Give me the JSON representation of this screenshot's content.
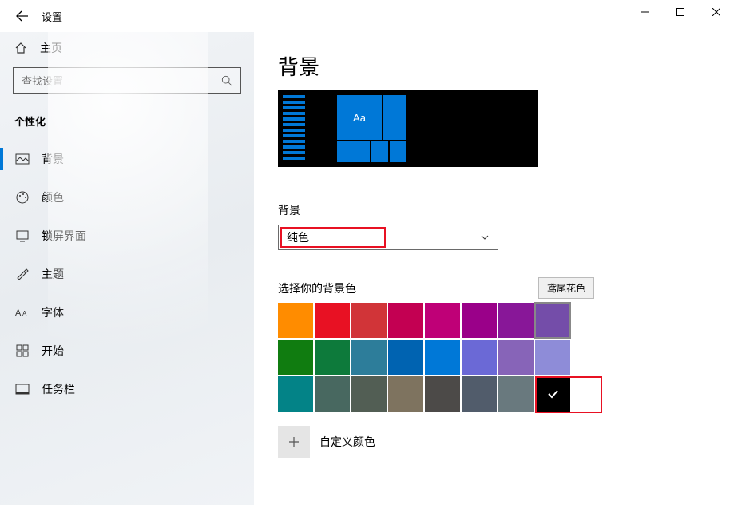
{
  "titlebar": {
    "title": "设置"
  },
  "sidebar": {
    "home": "主页",
    "search_placeholder": "查找设置",
    "section": "个性化",
    "items": [
      {
        "label": "背景",
        "selected": true
      },
      {
        "label": "颜色",
        "selected": false
      },
      {
        "label": "锁屏界面",
        "selected": false
      },
      {
        "label": "主题",
        "selected": false
      },
      {
        "label": "字体",
        "selected": false
      },
      {
        "label": "开始",
        "selected": false
      },
      {
        "label": "任务栏",
        "selected": false
      }
    ]
  },
  "content": {
    "title": "背景",
    "preview_sample_text": "Aa",
    "bg_label": "背景",
    "bg_value": "纯色",
    "pick_label": "选择你的背景色",
    "tooltip": "鸢尾花色",
    "custom_label": "自定义颜色",
    "colors_row1": [
      "#ff8c00",
      "#e81123",
      "#d13438",
      "#c30052",
      "#bf0077",
      "#9a0089",
      "#881798",
      "#744da9"
    ],
    "colors_row2": [
      "#107c10",
      "#0d7a3b",
      "#2d7d9a",
      "#0063b1",
      "#0078d7",
      "#6b69d6",
      "#8764b8",
      "#8e8cd8"
    ],
    "colors_row3": [
      "#038387",
      "#486860",
      "#525e54",
      "#7e735f",
      "#4c4a48",
      "#515c6b",
      "#69797e",
      "#000000"
    ],
    "hovered_index": 7,
    "selected_row3_index": 7
  }
}
